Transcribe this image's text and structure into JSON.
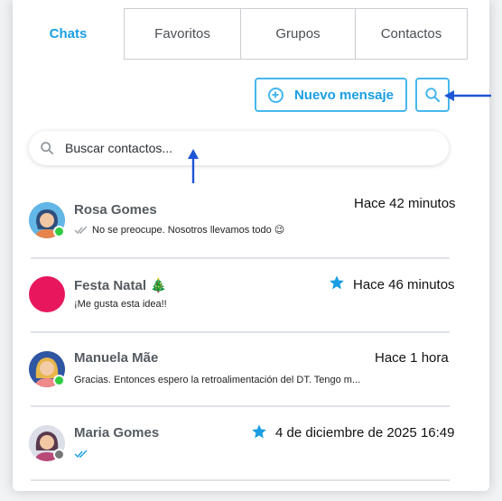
{
  "tabs": [
    {
      "label": "Chats",
      "active": true
    },
    {
      "label": "Favoritos",
      "active": false
    },
    {
      "label": "Grupos",
      "active": false
    },
    {
      "label": "Contactos",
      "active": false
    }
  ],
  "toolbar": {
    "new_message_label": "Nuevo mensaje",
    "search_icon": "search-icon"
  },
  "search": {
    "placeholder": "Buscar contactos..."
  },
  "chats": [
    {
      "name": "Rosa Gomes",
      "preview": "No se preocupe. Nosotros llevamos todo 😉",
      "time": "Hace 42 minutos",
      "status": "online",
      "favorite": false,
      "read_receipt": "double-check-gray"
    },
    {
      "name": "Festa Natal 🎄",
      "preview": "¡Me gusta esta idea!!",
      "time": "Hace 46 minutos",
      "status": "none",
      "favorite": true
    },
    {
      "name": "Manuela Mãe",
      "preview": "Gracias. Entonces espero la retroalimentación del DT. Tengo m...",
      "time": "Hace 1 hora",
      "status": "online",
      "favorite": false
    },
    {
      "name": "Maria Gomes",
      "preview": "",
      "time": "4 de diciembre de 2025 16:49",
      "status": "offline",
      "favorite": true,
      "read_receipt": "double-check-blue"
    }
  ],
  "colors": {
    "accent": "#1a9ee3",
    "accent_border": "#46b7ee",
    "online": "#2ecc40",
    "offline": "#777777",
    "group_avatar": "#e8175d",
    "annotation_arrow": "#1f56d6"
  }
}
